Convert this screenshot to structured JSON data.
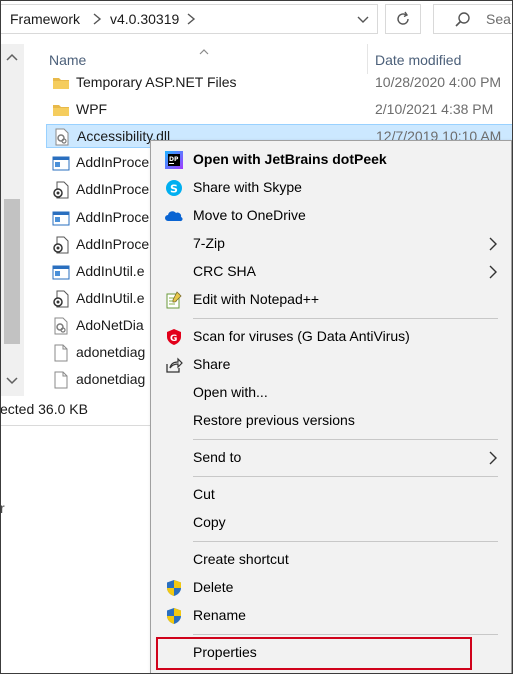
{
  "address_bar": {
    "crumbs": [
      "Framework",
      "v4.0.30319"
    ]
  },
  "search": {
    "placeholder": "Sea"
  },
  "columns": {
    "name": "Name",
    "date_modified": "Date modified"
  },
  "files": [
    {
      "name": "Temporary ASP.NET Files",
      "date": "10/28/2020 4:00 PM",
      "icon": "folder-icon"
    },
    {
      "name": "WPF",
      "date": "2/10/2021 4:38 PM",
      "icon": "folder-icon"
    },
    {
      "name": "Accessibility.dll",
      "date": "12/7/2019 10:10 AM",
      "icon": "dll-file-icon",
      "selected": true
    },
    {
      "name": "AddInProce",
      "date": "",
      "icon": "exe-window-icon"
    },
    {
      "name": "AddInProce",
      "date": "",
      "icon": "config-file-icon"
    },
    {
      "name": "AddInProce",
      "date": "",
      "icon": "exe-window-icon"
    },
    {
      "name": "AddInProce",
      "date": "",
      "icon": "config-file-icon"
    },
    {
      "name": "AddInUtil.e",
      "date": "",
      "icon": "exe-window-icon"
    },
    {
      "name": "AddInUtil.e",
      "date": "",
      "icon": "config-file-icon"
    },
    {
      "name": "AdoNetDia",
      "date": "",
      "icon": "dll-file-icon"
    },
    {
      "name": "adonetdiag",
      "date": "",
      "icon": "blank-file-icon"
    },
    {
      "name": "adonetdiag",
      "date": "",
      "icon": "blank-file-icon"
    }
  ],
  "status_bar": {
    "text": "ected  36.0 KB"
  },
  "desktop": {
    "text": "r"
  },
  "context_menu": {
    "items": [
      {
        "label": "Open with JetBrains dotPeek",
        "icon": "dotpeek-icon",
        "bold": true
      },
      {
        "label": "Share with Skype",
        "icon": "skype-icon"
      },
      {
        "label": "Move to OneDrive",
        "icon": "onedrive-icon"
      },
      {
        "label": "7-Zip",
        "submenu": true
      },
      {
        "label": "CRC SHA",
        "submenu": true
      },
      {
        "label": "Edit with Notepad++",
        "icon": "notepad-plus-plus-icon"
      },
      {
        "label": "Scan for viruses (G Data AntiVirus)",
        "icon": "gdata-antivirus-icon"
      },
      {
        "label": "Share",
        "icon": "share-icon"
      },
      {
        "label": "Open with..."
      },
      {
        "label": "Restore previous versions"
      },
      {
        "label": "Send to",
        "submenu": true
      },
      {
        "label": "Cut"
      },
      {
        "label": "Copy"
      },
      {
        "label": "Create shortcut"
      },
      {
        "label": "Delete",
        "icon": "uac-shield-icon"
      },
      {
        "label": "Rename",
        "icon": "uac-shield-icon"
      },
      {
        "label": "Properties"
      }
    ]
  },
  "colors": {
    "selection_bg": "#cce8ff",
    "selection_border": "#99d1ff",
    "menu_bg": "#f2f2f2",
    "highlight_box": "#d0021b",
    "folder": "#e8b94a"
  }
}
